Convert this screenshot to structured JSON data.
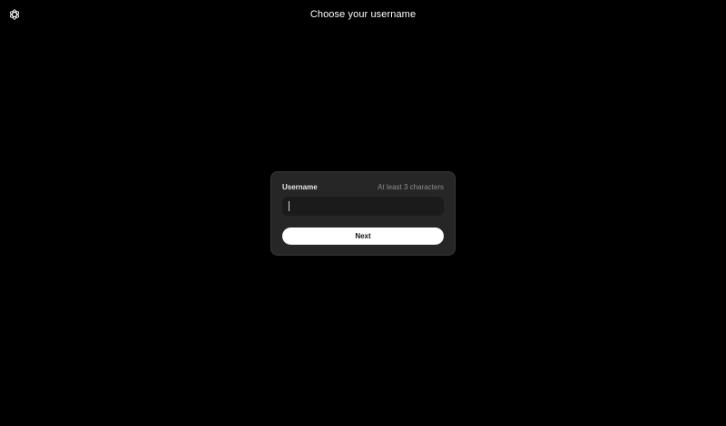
{
  "header": {
    "logo_icon": "openai-logo-icon",
    "title": "Choose your username"
  },
  "form": {
    "username_label": "Username",
    "username_hint": "At least 3 characters",
    "username_value": "",
    "next_label": "Next"
  },
  "colors": {
    "background": "#000000",
    "card": "#262626",
    "input": "#1b1b1b",
    "button": "#ffffff",
    "hint_text": "#8d8d8d"
  }
}
